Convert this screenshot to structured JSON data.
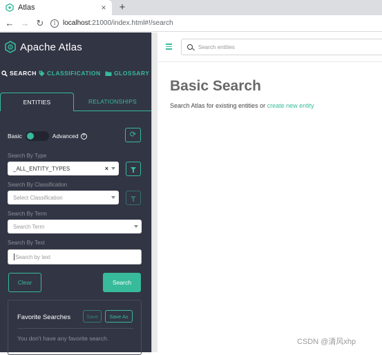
{
  "browser": {
    "tab_title": "Atlas",
    "tab_close": "×",
    "new_tab": "+",
    "url_host": "localhost",
    "url_rest": ":21000/index.html#!/search",
    "back": "←",
    "forward": "→",
    "reload": "↻",
    "info": "i"
  },
  "sidebar": {
    "brand": "Apache Atlas",
    "nav": [
      {
        "label": "SEARCH",
        "icon": "search-icon",
        "active": true
      },
      {
        "label": "CLASSIFICATION",
        "icon": "tag-icon",
        "active": false
      },
      {
        "label": "GLOSSARY",
        "icon": "folder-icon",
        "active": false
      }
    ],
    "subtabs": {
      "entities": "ENTITIES",
      "relationships": "RELATIONSHIPS"
    },
    "toggle": {
      "basic": "Basic",
      "advanced": "Advanced",
      "state": "basic"
    },
    "fields": {
      "type_label": "Search By Type",
      "type_value": "_ALL_ENTITY_TYPES",
      "type_clear": "×",
      "classification_label": "Search By Classification",
      "classification_placeholder": "Select Classification",
      "term_label": "Search By Term",
      "term_placeholder": "Search Term",
      "text_label": "Search By Text",
      "text_placeholder": "Search by text"
    },
    "buttons": {
      "clear": "Clear",
      "search": "Search"
    },
    "favorites": {
      "title": "Favorite Searches",
      "save": "Save",
      "save_as": "Save As",
      "empty": "You don't have any favorite search."
    }
  },
  "main": {
    "search_placeholder": "Search entities",
    "title": "Basic Search",
    "description_prefix": "Search Atlas for existing entities or ",
    "description_link": "create new entity"
  },
  "watermark": "CSDN @清风xhp",
  "colors": {
    "accent": "#37bb9b",
    "sidebar_bg": "#323544",
    "title_gray": "#686868"
  }
}
